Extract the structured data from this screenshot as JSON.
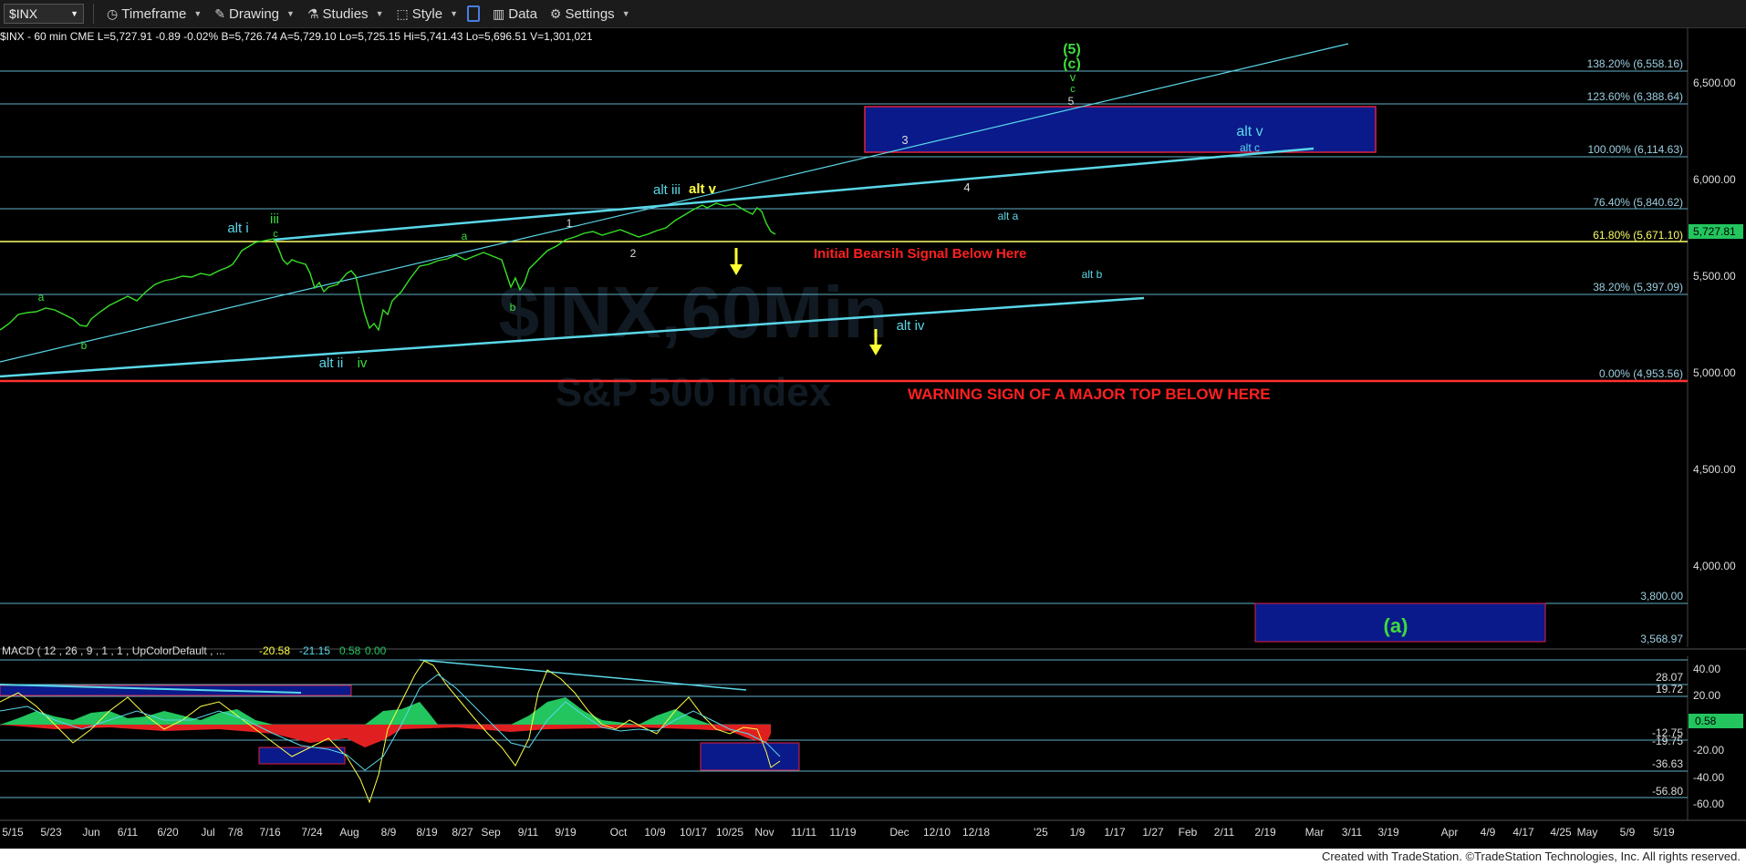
{
  "toolbar": {
    "symbol": "$INX",
    "items": [
      {
        "label": "Timeframe",
        "icon": "clock-icon"
      },
      {
        "label": "Drawing",
        "icon": "pencil-icon"
      },
      {
        "label": "Studies",
        "icon": "flask-icon"
      },
      {
        "label": "Style",
        "icon": "style-icon"
      },
      {
        "label": "Data",
        "icon": "bars-icon"
      },
      {
        "label": "Settings",
        "icon": "gear-icon"
      }
    ]
  },
  "info_bar": "$INX - 60 min  CME  L=5,727.91  -0.89  -0.02%  B=5,726.74  A=5,729.10  Lo=5,725.15  Hi=5,741.43  Lo=5,696.51  V=1,301,021",
  "watermark": {
    "line1": "$INX,60Min",
    "line2": "S&P 500 Index"
  },
  "price_axis": {
    "labels": [
      "6,500.00",
      "6,000.00",
      "5,500.00",
      "5,000.00",
      "4,500.00",
      "4,000.00"
    ],
    "current": "5,727.81",
    "current_color": "#22c55e"
  },
  "fib_levels": [
    {
      "label": "138.20% (6,558.16)"
    },
    {
      "label": "123.60% (6,388.64)"
    },
    {
      "label": "100.00% (6,114.63)"
    },
    {
      "label": "76.40% (5,840.62)"
    },
    {
      "label": "61.80% (5,671.10)",
      "color": "#ffff66"
    },
    {
      "label": "38.20% (5,397.09)"
    },
    {
      "label": "0.00% (4,953.56)"
    },
    {
      "label": "3,800.00"
    },
    {
      "label": "3,568.97"
    }
  ],
  "annotations": {
    "bearish": "Initial Bearsih Signal Below Here",
    "warning": "WARNING SIGN OF A MAJOR TOP BELOW HERE",
    "wave_a_big": "(a)",
    "wave5_top": "(5)",
    "wave_c_top": "(c)",
    "v_lbl": "v",
    "c_lbl": "c",
    "n5": "5",
    "n3": "3",
    "n4": "4",
    "n1": "1",
    "n2": "2",
    "alt_v_box": "alt v",
    "alt_c": "alt c",
    "alt_iii": "alt iii",
    "alt_v": "alt v",
    "alt_a": "alt a",
    "alt_b": "alt b",
    "alt_iv": "alt iv",
    "alt_i": "alt i",
    "iii": "iii",
    "c_small": "c",
    "a1": "a",
    "b1": "b",
    "a2": "a",
    "b2": "b",
    "alt_ii": "alt ii",
    "iv": "iv"
  },
  "macd": {
    "header": "MACD ( 12 , 26 , 9 , 1 , 1 , UpColorDefault , ...",
    "value1": "-20.58",
    "value2": "-21.15",
    "value3": "0.58",
    "value4": "0.00",
    "axis": [
      "40.00",
      "20.00",
      "-20.00",
      "-40.00",
      "-60.00"
    ],
    "levels": [
      "28.07",
      "19.72",
      "-12.75",
      "-19.75",
      "-36.63",
      "-56.80"
    ],
    "current": "0.58"
  },
  "date_axis": [
    "5/15",
    "5/23",
    "Jun",
    "6/11",
    "6/20",
    "Jul",
    "7/8",
    "7/16",
    "7/24",
    "Aug",
    "8/9",
    "8/19",
    "8/27",
    "Sep",
    "9/11",
    "9/19",
    "Oct",
    "10/9",
    "10/17",
    "10/25",
    "Nov",
    "11/11",
    "11/19",
    "Dec",
    "12/10",
    "12/18",
    "'25",
    "1/9",
    "1/17",
    "1/27",
    "Feb",
    "2/11",
    "2/19",
    "Mar",
    "3/11",
    "3/19",
    "Apr",
    "4/9",
    "4/17",
    "4/25",
    "May",
    "5/9",
    "5/19"
  ],
  "footer": "Created with TradeStation. ©TradeStation Technologies, Inc. All rights reserved."
}
